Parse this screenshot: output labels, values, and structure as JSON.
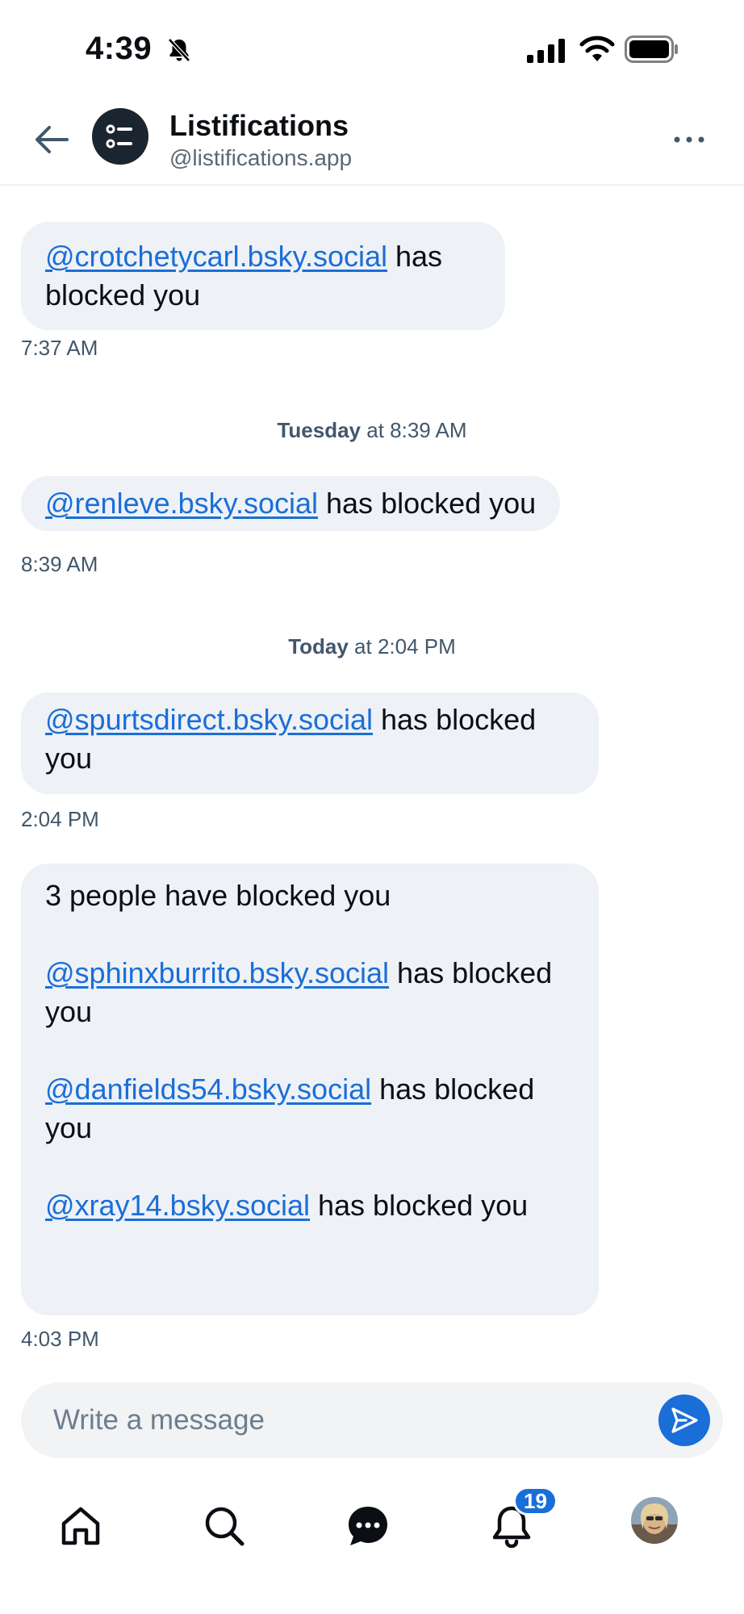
{
  "status_bar": {
    "time": "4:39",
    "icons": [
      "bell-slash-icon",
      "cellular-signal-icon",
      "wifi-icon",
      "battery-icon"
    ]
  },
  "header": {
    "name": "Listifications",
    "handle": "@listifications.app",
    "icons": [
      "back-arrow-icon",
      "list-avatar-icon",
      "more-options-icon"
    ]
  },
  "messages": [
    {
      "segments": [
        {
          "handle": "@crotchetycarl.bsky.social",
          "text": " has blocked you"
        }
      ],
      "time": "7:37 AM"
    },
    {
      "divider": {
        "day": "Tuesday",
        "rest": " at 8:39 AM"
      },
      "segments": [
        {
          "handle": "@renleve.bsky.social",
          "text": " has blocked you"
        }
      ],
      "time": "8:39 AM"
    },
    {
      "divider": {
        "day": "Today",
        "rest": " at 2:04 PM"
      },
      "segments": [
        {
          "handle": "@spurtsdirect.bsky.social",
          "text": " has blocked you"
        }
      ],
      "time": "2:04 PM"
    },
    {
      "intro": "3 people have blocked you",
      "segments": [
        {
          "handle": "@sphinxburrito.bsky.social",
          "text": " has blocked you"
        },
        {
          "handle": "@danfields54.bsky.social",
          "text": " has blocked you"
        },
        {
          "handle": "@xray14.bsky.social",
          "text": " has blocked you"
        }
      ],
      "time": "4:03 PM"
    }
  ],
  "composer": {
    "placeholder": "Write a message",
    "send_icon": "send-icon"
  },
  "tabbar": {
    "items": [
      "home-icon",
      "search-icon",
      "chat-icon",
      "notifications-icon",
      "profile-avatar"
    ],
    "notification_count": "19"
  },
  "colors": {
    "link": "#1a6ed8",
    "bubble": "#eef1f6",
    "accent": "#1a6ed8"
  }
}
